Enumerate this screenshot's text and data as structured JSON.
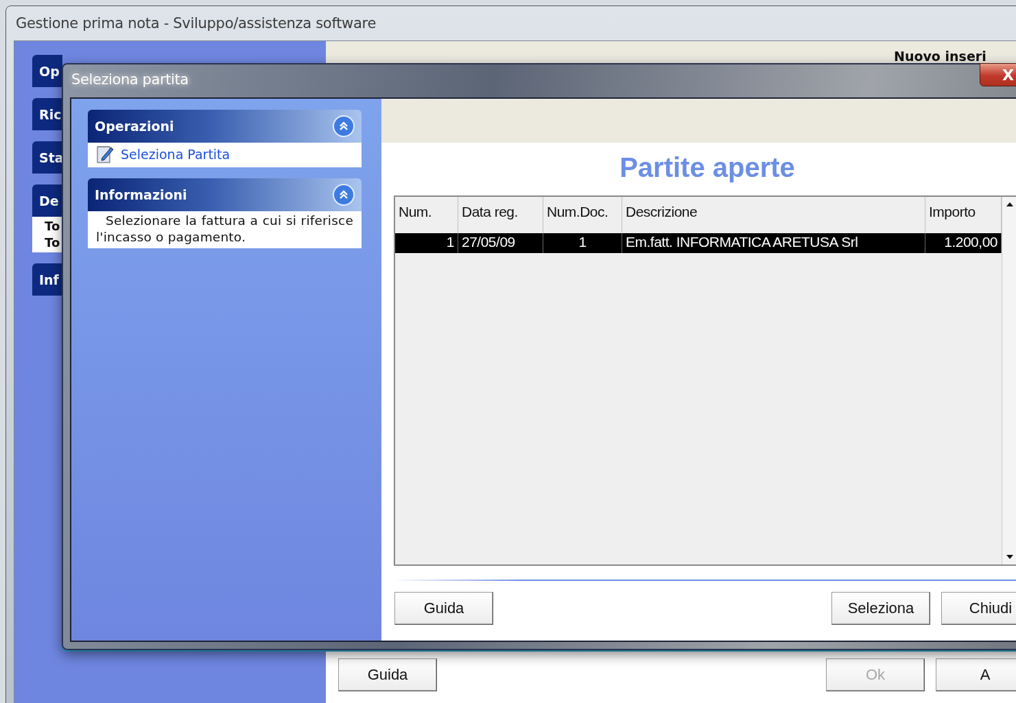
{
  "back_window": {
    "title": "Gestione prima nota - Sviluppo/assistenza software",
    "sidebar_groups": [
      {
        "label": "Op"
      },
      {
        "label": "Ric"
      },
      {
        "label": "Sta"
      },
      {
        "label": "De",
        "items": [
          "To",
          "To"
        ]
      },
      {
        "label": "Inf"
      }
    ],
    "heading": "Nuovo inseri",
    "buttons": [
      {
        "label": "Guida",
        "disabled": false
      },
      {
        "label": "Ok",
        "disabled": true
      },
      {
        "label": "A",
        "disabled": false
      }
    ]
  },
  "dialog": {
    "title": "Seleziona partita",
    "close_label": "X",
    "panels": [
      {
        "title": "Operazioni",
        "expanded": true,
        "kind": "links",
        "items": [
          "Seleziona Partita"
        ]
      },
      {
        "title": "Informazioni",
        "expanded": true,
        "kind": "text",
        "text": "Selezionare la fattura a cui si riferisce l'incasso o pagamento."
      }
    ],
    "heading": "Partite aperte",
    "table": {
      "columns": [
        "Num.",
        "Data reg.",
        "Num.Doc.",
        "Descrizione",
        "Importo"
      ],
      "rows": [
        {
          "cells": [
            "1",
            "27/05/09",
            "1",
            "Em.fatt. INFORMATICA ARETUSA Srl",
            "1.200,00"
          ],
          "selected": true
        }
      ]
    },
    "buttons": [
      "Guida",
      "Seleziona",
      "Chiudi"
    ]
  }
}
